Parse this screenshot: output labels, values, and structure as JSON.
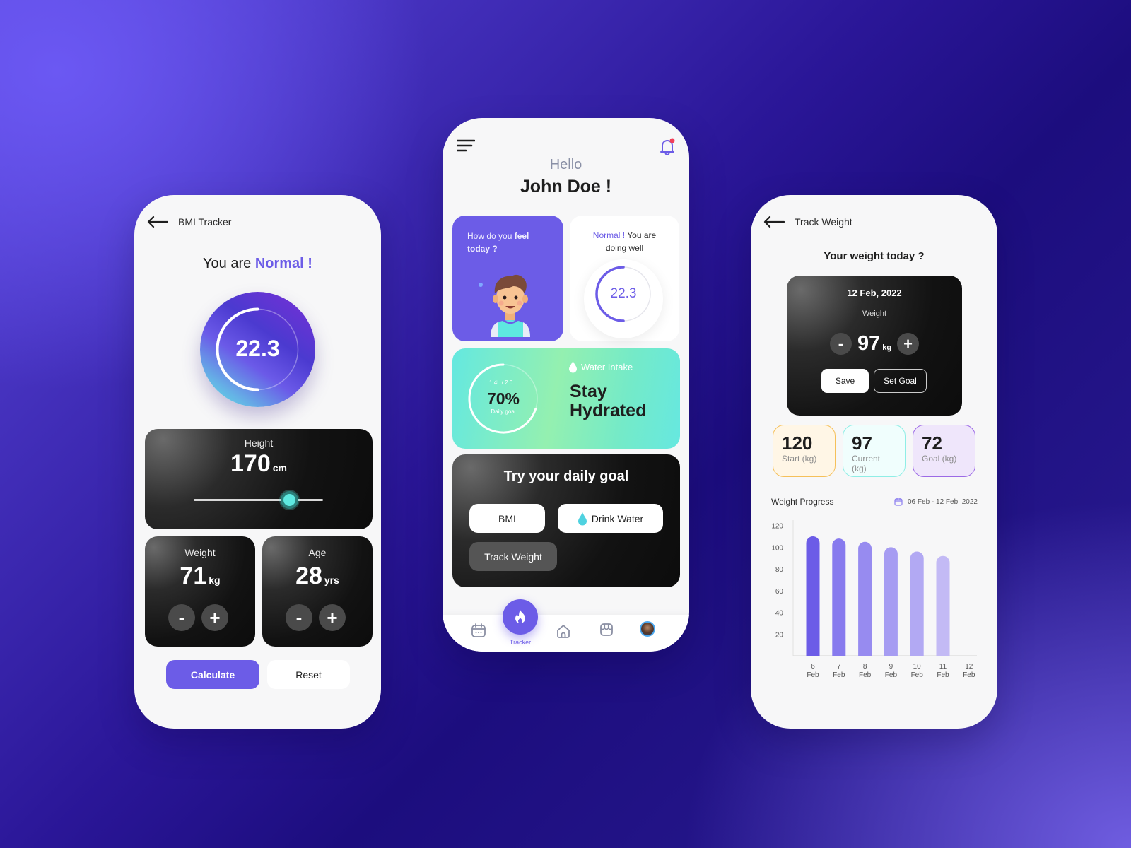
{
  "theme": {
    "accent": "#6c5ce7",
    "teal": "#5ee8e0",
    "dark_card": "#121212",
    "start_card_border": "#f5c05a",
    "current_card_border": "#8feee6",
    "goal_card_border": "#9c6ae6"
  },
  "bmi_screen": {
    "title": "BMI Tracker",
    "status_prefix": "You are",
    "status_value": "Normal !",
    "bmi_value": "22.3",
    "bmi_ring_fraction": 0.5,
    "height": {
      "label": "Height",
      "value": "170",
      "unit": "cm",
      "slider_fraction": 0.74
    },
    "weight": {
      "label": "Weight",
      "value": "71",
      "unit": "kg",
      "minus": "-",
      "plus": "+"
    },
    "age": {
      "label": "Age",
      "value": "28",
      "unit": "yrs",
      "minus": "-",
      "plus": "+"
    },
    "calculate_label": "Calculate",
    "reset_label": "Reset"
  },
  "home_screen": {
    "greeting": "Hello",
    "user_name": "John Doe !",
    "feel_card": {
      "text_plain": "How do you ",
      "text_bold_1": "feel",
      "text_bold_2": "today ?"
    },
    "bmi_card": {
      "status": "Normal !",
      "text_1": " You are",
      "text_2": "doing well",
      "value": "22.3",
      "ring_fraction": 0.5
    },
    "water_card": {
      "amount": "1.4L / 2.0 L",
      "percent": "70%",
      "percent_value": 0.7,
      "sub": "Daily goal",
      "label": "Water Intake",
      "headline_1": "Stay",
      "headline_2": "Hydrated"
    },
    "goal_card": {
      "title": "Try your daily goal",
      "buttons": [
        "BMI",
        "Drink Water",
        "Track Weight"
      ]
    },
    "nav": {
      "items": [
        "calendar",
        "tracker",
        "home",
        "store",
        "profile"
      ],
      "active_label": "Tracker"
    }
  },
  "weight_screen": {
    "title": "Track Weight",
    "question": "Your weight today ?",
    "date": "12 Feb, 2022",
    "weight_label": "Weight",
    "weight_value": "97",
    "weight_unit": "kg",
    "minus": "-",
    "plus": "+",
    "save_label": "Save",
    "set_goal_label": "Set Goal",
    "stats": [
      {
        "value": "120",
        "label": "Start (kg)"
      },
      {
        "value": "97",
        "label": "Current (kg)"
      },
      {
        "value": "72",
        "label": "Goal (kg)"
      }
    ],
    "progress_title": "Weight Progress",
    "date_range": "06 Feb - 12 Feb, 2022"
  },
  "chart_data": {
    "type": "bar",
    "title": "Weight Progress",
    "subtitle": "06 Feb - 12 Feb, 2022",
    "categories": [
      "6 Feb",
      "7 Feb",
      "8 Feb",
      "9 Feb",
      "10 Feb",
      "11 Feb",
      "12 Feb"
    ],
    "category_lines": [
      [
        "6",
        "Feb"
      ],
      [
        "7",
        "Feb"
      ],
      [
        "8",
        "Feb"
      ],
      [
        "9",
        "Feb"
      ],
      [
        "10",
        "Feb"
      ],
      [
        "11",
        "Feb"
      ],
      [
        "12",
        "Feb"
      ]
    ],
    "values": [
      110,
      108,
      105,
      100,
      96,
      92,
      null
    ],
    "bar_colors": [
      "#6c5ce7",
      "#877aee",
      "#978bf0",
      "#a69cf2",
      "#b2a9f3",
      "#c3baf5",
      "#d4cdf7"
    ],
    "xlabel": "",
    "ylabel": "",
    "yticks": [
      20,
      40,
      60,
      80,
      100,
      120
    ],
    "ylim": [
      0,
      125
    ],
    "grid": false,
    "legend": "none"
  }
}
